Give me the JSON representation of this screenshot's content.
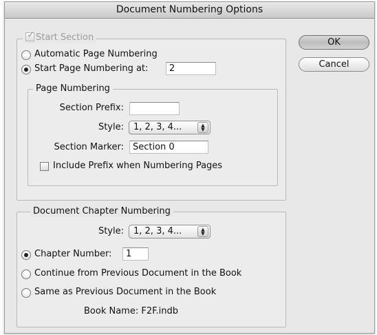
{
  "window": {
    "title": "Document Numbering Options"
  },
  "buttons": {
    "ok_label": "OK",
    "cancel_label": "Cancel"
  },
  "start_section": {
    "label": "Start Section",
    "checked": true,
    "automatic_label": "Automatic Page Numbering",
    "start_at_label": "Start Page Numbering at:",
    "start_at_value": "2",
    "page_numbering": {
      "label": "Page Numbering",
      "section_prefix_label": "Section Prefix:",
      "section_prefix_value": "",
      "style_label": "Style:",
      "style_value": "1, 2, 3, 4...",
      "section_marker_label": "Section Marker:",
      "section_marker_value": "Section 0",
      "include_prefix_label": "Include Prefix when Numbering Pages"
    }
  },
  "chapter": {
    "label": "Document Chapter Numbering",
    "style_label": "Style:",
    "style_value": "1, 2, 3, 4...",
    "chapter_number_label": "Chapter Number:",
    "chapter_number_value": "1",
    "continue_label": "Continue from Previous Document in the Book",
    "same_label": "Same as Previous Document in the Book",
    "book_name_label": "Book Name: F2F.indb"
  }
}
